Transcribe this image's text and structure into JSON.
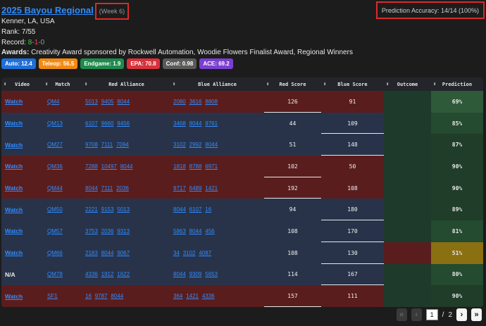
{
  "event": {
    "name": "2025 Bayou Regional",
    "week": "(Week 6)",
    "location": "Kenner, LA, USA",
    "rank_label": "Rank:",
    "rank_value": "7/55",
    "record_label": "Record:",
    "record_w": "8",
    "record_l": "1",
    "record_t": "0",
    "awards_label": "Awards:",
    "awards_text": "Creativity Award sponsored by Rockwell Automation, Woodie Flowers Finalist Award, Regional Winners",
    "accuracy": "Prediction Accuracy: 14/14 (100%)"
  },
  "badges": [
    {
      "label": "Auto: 12.4",
      "color": "#1e6fd9"
    },
    {
      "label": "Teleop: 56.5",
      "color": "#f08a16"
    },
    {
      "label": "Endgame: 1.9",
      "color": "#1f8a4c"
    },
    {
      "label": "EPA: 70.8",
      "color": "#d9313b"
    },
    {
      "label": "Conf: 0.98",
      "color": "#5a5a5a"
    },
    {
      "label": "ACE: 69.2",
      "color": "#7b3fd1"
    }
  ],
  "table": {
    "headers": [
      "Video",
      "Match",
      "Red Alliance",
      "Blue Alliance",
      "Red Score",
      "Blue Score",
      "Outcome",
      "Prediction"
    ],
    "rows": [
      {
        "video": "Watch",
        "match": "QM4",
        "red": [
          "5013",
          "9405",
          "8044"
        ],
        "blue": [
          "2080",
          "3616",
          "8808"
        ],
        "red_score": "126",
        "blue_score": "91",
        "prediction": "69%",
        "row": "red",
        "outcome": "green",
        "pred": "g1"
      },
      {
        "video": "Watch",
        "match": "QM13",
        "red": [
          "6107",
          "9660",
          "9456"
        ],
        "blue": [
          "3468",
          "8044",
          "9761"
        ],
        "red_score": "44",
        "blue_score": "109",
        "prediction": "85%",
        "row": "blue",
        "outcome": "green",
        "pred": "g2"
      },
      {
        "video": "Watch",
        "match": "QM27",
        "red": [
          "9708",
          "7111",
          "7094"
        ],
        "blue": [
          "3102",
          "2992",
          "8044"
        ],
        "red_score": "51",
        "blue_score": "148",
        "prediction": "87%",
        "row": "blue",
        "outcome": "green",
        "pred": "g3"
      },
      {
        "video": "Watch",
        "match": "QM36",
        "red": [
          "7288",
          "10497",
          "8044"
        ],
        "blue": [
          "1818",
          "8788",
          "6971"
        ],
        "red_score": "102",
        "blue_score": "50",
        "prediction": "90%",
        "row": "red",
        "outcome": "green",
        "pred": "g3"
      },
      {
        "video": "Watch",
        "match": "QM44",
        "red": [
          "8044",
          "7111",
          "2036"
        ],
        "blue": [
          "9717",
          "6489",
          "1421"
        ],
        "red_score": "192",
        "blue_score": "108",
        "prediction": "90%",
        "row": "red",
        "outcome": "green",
        "pred": "g3"
      },
      {
        "video": "Watch",
        "match": "QM50",
        "red": [
          "2221",
          "9153",
          "5013"
        ],
        "blue": [
          "8044",
          "6107",
          "16"
        ],
        "red_score": "94",
        "blue_score": "180",
        "prediction": "89%",
        "row": "blue",
        "outcome": "green",
        "pred": "g3"
      },
      {
        "video": "Watch",
        "match": "QM57",
        "red": [
          "3753",
          "2036",
          "9313"
        ],
        "blue": [
          "5863",
          "8044",
          "456"
        ],
        "red_score": "108",
        "blue_score": "170",
        "prediction": "81%",
        "row": "blue",
        "outcome": "green",
        "pred": "g2"
      },
      {
        "video": "Watch",
        "match": "QM66",
        "red": [
          "2183",
          "8044",
          "9067"
        ],
        "blue": [
          "34",
          "3102",
          "4087"
        ],
        "red_score": "108",
        "blue_score": "130",
        "prediction": "51%",
        "row": "blue",
        "outcome": "red",
        "pred": "gold"
      },
      {
        "video": "N/A",
        "match": "QM78",
        "red": [
          "4336",
          "1912",
          "1622"
        ],
        "blue": [
          "8044",
          "9309",
          "5653"
        ],
        "red_score": "114",
        "blue_score": "167",
        "prediction": "80%",
        "row": "blue",
        "outcome": "green",
        "pred": "g2"
      },
      {
        "video": "Watch",
        "match": "SF1",
        "red": [
          "16",
          "9787",
          "8044"
        ],
        "blue": [
          "364",
          "1421",
          "4336"
        ],
        "red_score": "157",
        "blue_score": "111",
        "prediction": "90%",
        "row": "red",
        "outcome": "green",
        "pred": "g3"
      }
    ]
  },
  "pager": {
    "first": "«",
    "prev": "‹",
    "page": "1",
    "sep": "/",
    "total": "2",
    "next": "›",
    "last": "»"
  }
}
